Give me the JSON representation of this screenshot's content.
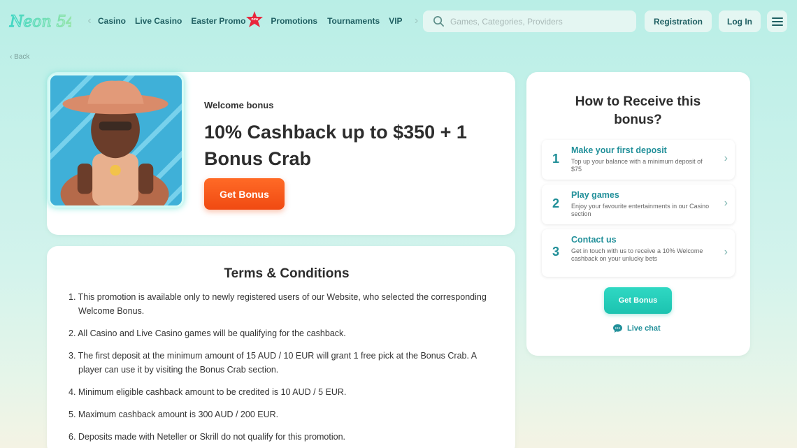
{
  "header": {
    "logo_text": "Neon 54",
    "nav_items": [
      "Casino",
      "Live Casino",
      "Easter Promo",
      "Promotions",
      "Tournaments",
      "VIP"
    ],
    "new_badge": "new",
    "search_placeholder": "Games, Categories, Providers",
    "registration_label": "Registration",
    "login_label": "Log In"
  },
  "back_label": "‹ Back",
  "bonus": {
    "subtitle": "Welcome bonus",
    "title": "10% Cashback up to $350 + 1 Bonus Crab",
    "button": "Get Bonus"
  },
  "terms": {
    "title": "Terms & Conditions",
    "items": [
      "1. This promotion is available only to newly registered users of our Website, who selected the corresponding Welcome Bonus.",
      "2. All Casino and Live Casino games will be qualifying for the cashback.",
      "3. The first deposit at the minimum amount of 15 AUD / 10 EUR will grant 1 free pick at the Bonus Crab. A player can use it by visiting the Bonus Crab section.",
      "4. Minimum eligible cashback amount to be credited is 10 AUD / 5 EUR.",
      "5. Maximum cashback amount is 300 AUD / 200 EUR.",
      "6. Deposits made with Neteller or Skrill do not qualify for this promotion."
    ]
  },
  "sidebar": {
    "title": "How to Receive this bonus?",
    "steps": [
      {
        "num": "1",
        "title": "Make your first deposit",
        "desc": "Top up your balance with a minimum deposit of $75"
      },
      {
        "num": "2",
        "title": "Play games",
        "desc": "Enjoy your favourite entertainments in our Casino section"
      },
      {
        "num": "3",
        "title": "Contact us",
        "desc": "Get in touch with us to receive a 10% Welcome cashback on your unlucky bets"
      }
    ],
    "button": "Get Bonus",
    "live_chat": "Live chat"
  },
  "colors": {
    "accent_teal": "#22909a",
    "cta_orange": "#f04a12",
    "cta_teal": "#1cc3b0",
    "badge_red": "#e8263c"
  },
  "icons": [
    "logo-icon",
    "chevron-left-icon",
    "chevron-right-icon",
    "star-badge-icon",
    "search-icon",
    "hamburger-menu-icon",
    "chat-bubble-icon"
  ]
}
